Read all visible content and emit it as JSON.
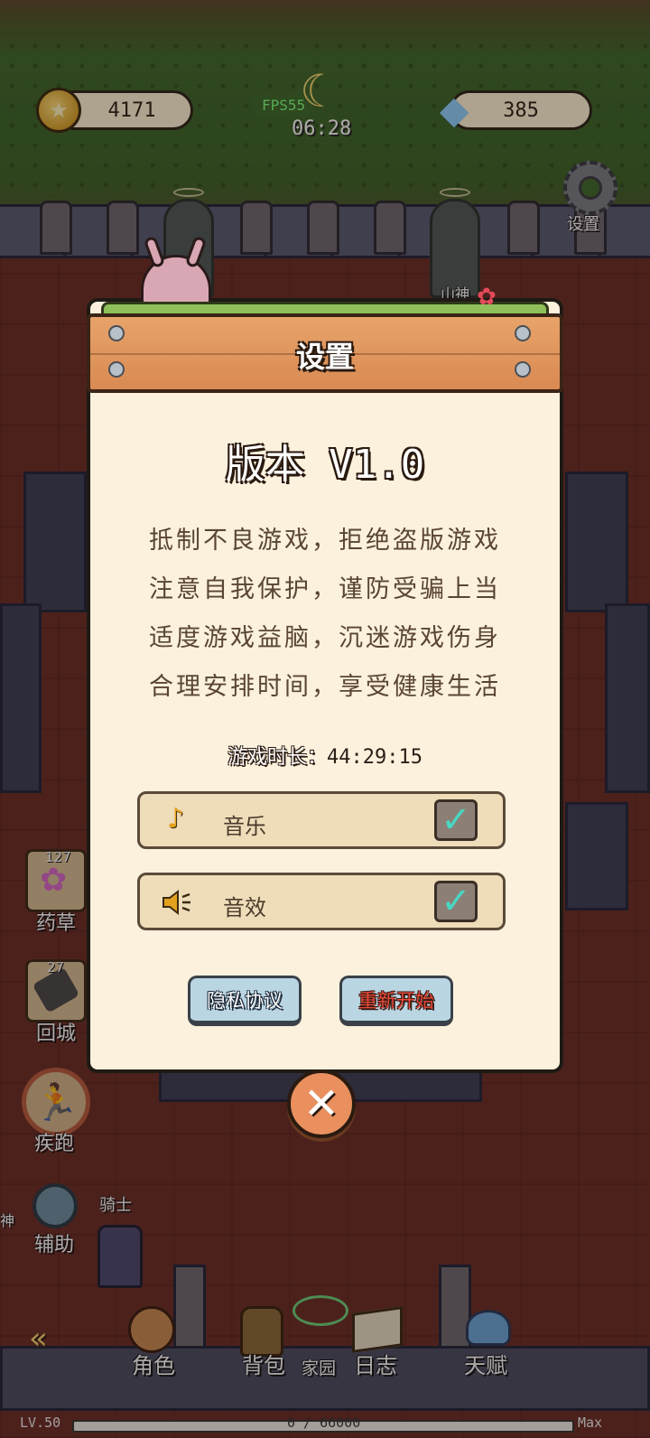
{
  "hud": {
    "gold": "4171",
    "gems": "385",
    "fps": "FPS55",
    "clock": "06:28",
    "settings_label": "设置",
    "icons": {
      "gold": "star-coin-icon",
      "gems": "diamond-icon",
      "time": "moon-icon",
      "settings": "gear-icon"
    }
  },
  "scene": {
    "statue_name": "山神",
    "npc_name": "骑士",
    "left_shrine": "神"
  },
  "side": {
    "herb": {
      "count": "127",
      "label": "药草",
      "icon": "flower-icon"
    },
    "town": {
      "count": "27",
      "label": "回城",
      "icon": "scroll-icon"
    },
    "sprint": {
      "label": "疾跑",
      "icon": "running-man-icon"
    },
    "assist": {
      "label": "辅助",
      "icon": "assist-wheel-icon"
    }
  },
  "bottom": {
    "nav": [
      {
        "label": "角色",
        "icon": "character-icon"
      },
      {
        "label": "背包",
        "icon": "backpack-icon"
      },
      {
        "label": "家园",
        "icon": "home-icon"
      },
      {
        "label": "日志",
        "icon": "book-icon"
      },
      {
        "label": "天赋",
        "icon": "wings-icon"
      }
    ],
    "level": "LV.50",
    "xp": "0 / 66000",
    "xp_fraction": 0,
    "max": "Max"
  },
  "dialog": {
    "title": "设置",
    "version": "版本 V1.0",
    "notice": [
      "抵制不良游戏，拒绝盗版游戏",
      "注意自我保护，谨防受骗上当",
      "适度游戏益脑，沉迷游戏伤身",
      "合理安排时间，享受健康生活"
    ],
    "playtime_label": "游戏时长：",
    "playtime_value": "44:29:15",
    "music_label": "音乐",
    "music_on": true,
    "sfx_label": "音效",
    "sfx_on": true,
    "check_mark": "✓",
    "privacy_button": "隐私协议",
    "restart_button": "重新开始",
    "close_glyph": "✕",
    "colors": {
      "restart_text": "#e64a3a",
      "check": "#49d6c2",
      "panel": "#fbf1dc",
      "banner": "#e09a5e"
    }
  }
}
